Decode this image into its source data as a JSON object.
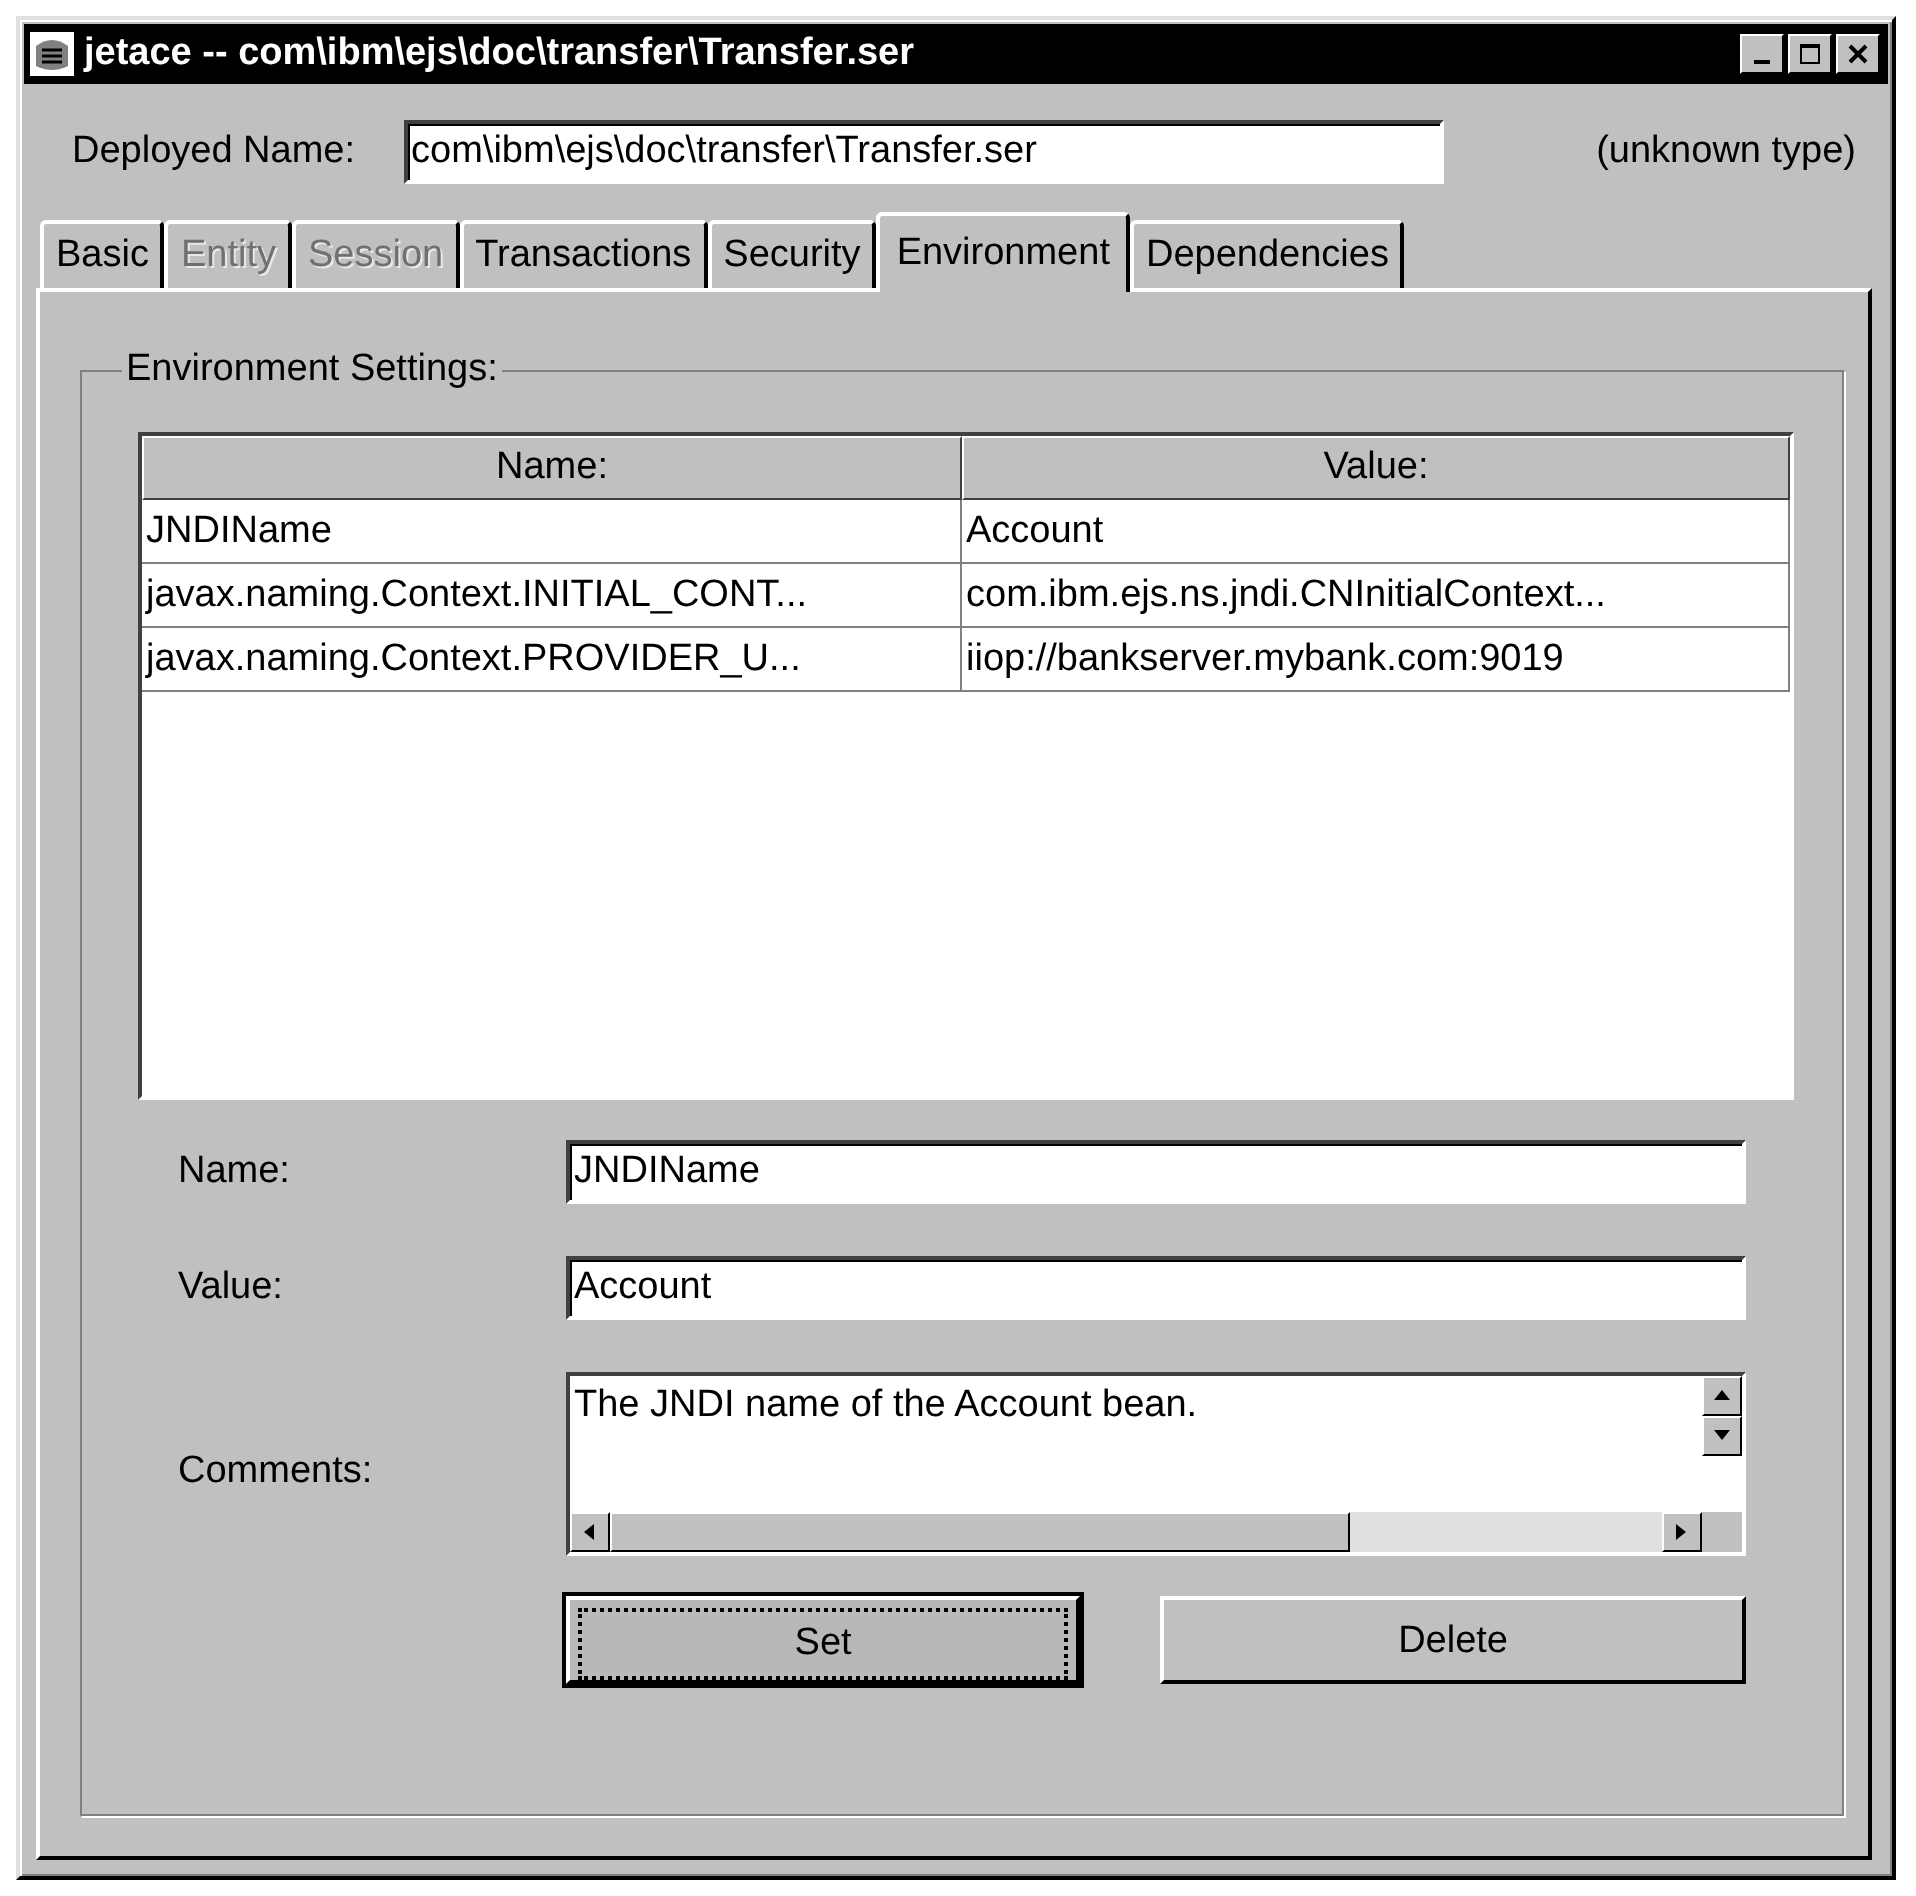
{
  "window": {
    "title": "jetace -- com\\ibm\\ejs\\doc\\transfer\\Transfer.ser"
  },
  "deployed_name": {
    "label": "Deployed Name:",
    "value": "com\\ibm\\ejs\\doc\\transfer\\Transfer.ser",
    "type_note": "(unknown type)"
  },
  "tabs": [
    {
      "label": "Basic",
      "selected": false,
      "disabled": false
    },
    {
      "label": "Entity",
      "selected": false,
      "disabled": true
    },
    {
      "label": "Session",
      "selected": false,
      "disabled": true
    },
    {
      "label": "Transactions",
      "selected": false,
      "disabled": false
    },
    {
      "label": "Security",
      "selected": false,
      "disabled": false
    },
    {
      "label": "Environment",
      "selected": true,
      "disabled": false
    },
    {
      "label": "Dependencies",
      "selected": false,
      "disabled": false
    }
  ],
  "group": {
    "title": "Environment Settings:"
  },
  "table": {
    "columns": [
      "Name:",
      "Value:"
    ],
    "rows": [
      [
        "JNDIName",
        "Account"
      ],
      [
        "javax.naming.Context.INITIAL_CONT...",
        "com.ibm.ejs.ns.jndi.CNInitialContext..."
      ],
      [
        "javax.naming.Context.PROVIDER_U...",
        "iiop://bankserver.mybank.com:9019"
      ]
    ]
  },
  "form": {
    "name": {
      "label": "Name:",
      "value": "JNDIName"
    },
    "value": {
      "label": "Value:",
      "value": "Account"
    },
    "comments": {
      "label": "Comments:",
      "value": "The JNDI name of the Account bean."
    }
  },
  "buttons": [
    {
      "label": "Set",
      "focused": true
    },
    {
      "label": "Delete",
      "focused": false
    }
  ]
}
